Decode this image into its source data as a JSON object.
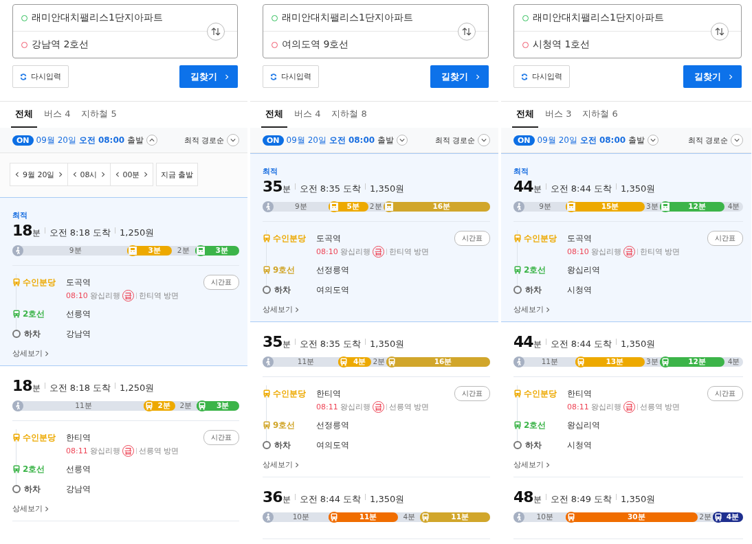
{
  "panels": [
    {
      "origin": "래미안대치팰리스1단지아파트",
      "destination": "강남역 2호선",
      "reset_button": "다시입력",
      "search_button": "길찾기",
      "tabs": [
        {
          "label": "전체",
          "selected": true
        },
        {
          "label": "버스 4",
          "selected": false
        },
        {
          "label": "지하철 5",
          "selected": false
        }
      ],
      "departure": {
        "badge": "ON",
        "datetime": "09월 20일 **오전 08:00**",
        "label": "출발",
        "expanded": true
      },
      "sort": "최적 경로순",
      "time_picker": {
        "fields": [
          "9월 20일",
          "08시",
          "00분"
        ],
        "now_button": "지금 출발"
      },
      "routes": [
        {
          "selected": true,
          "best_label": "최적",
          "minutes": "18",
          "unit": "분",
          "arrival": "오전 8:18 도착",
          "fare": "1,250원",
          "segments": [
            {
              "kind": "walk",
              "label": "9분"
            },
            {
              "kind": "ride",
              "label": "3분",
              "color": "#eda900"
            },
            {
              "kind": "walk",
              "label": "2분"
            },
            {
              "kind": "ride",
              "label": "3분",
              "color": "#3cb449"
            }
          ],
          "legs": [
            {
              "kind": "ride",
              "line": "수인분당",
              "color": "#eda900",
              "station": "도곡역",
              "timetable": "시간표",
              "departure": {
                "time": "08:10",
                "direction": "왕십리행",
                "badge": "급",
                "toward": "한티역 방면"
              }
            },
            {
              "kind": "ride",
              "line": "2호선",
              "color": "#3cb449",
              "station": "선릉역"
            },
            {
              "kind": "exit",
              "line": "하차",
              "station": "강남역"
            }
          ],
          "details_link": "상세보기"
        },
        {
          "selected": false,
          "minutes": "18",
          "unit": "분",
          "arrival": "오전 8:18 도착",
          "fare": "1,250원",
          "segments": [
            {
              "kind": "walk",
              "label": "11분"
            },
            {
              "kind": "ride",
              "label": "2분",
              "color": "#eda900"
            },
            {
              "kind": "walk",
              "label": "2분"
            },
            {
              "kind": "ride",
              "label": "3분",
              "color": "#3cb449"
            }
          ],
          "legs": [
            {
              "kind": "ride",
              "line": "수인분당",
              "color": "#eda900",
              "station": "한티역",
              "timetable": "시간표",
              "departure": {
                "time": "08:11",
                "direction": "왕십리행",
                "badge": "급",
                "toward": "선릉역 방면"
              }
            },
            {
              "kind": "ride",
              "line": "2호선",
              "color": "#3cb449",
              "station": "선릉역"
            },
            {
              "kind": "exit",
              "line": "하차",
              "station": "강남역"
            }
          ],
          "details_link": "상세보기"
        }
      ]
    },
    {
      "origin": "래미안대치팰리스1단지아파트",
      "destination": "여의도역 9호선",
      "reset_button": "다시입력",
      "search_button": "길찾기",
      "tabs": [
        {
          "label": "전체",
          "selected": true
        },
        {
          "label": "버스 4",
          "selected": false
        },
        {
          "label": "지하철 8",
          "selected": false
        }
      ],
      "departure": {
        "badge": "ON",
        "datetime": "09월 20일 **오전 08:00**",
        "label": "출발",
        "expanded": false
      },
      "sort": "최적 경로순",
      "routes": [
        {
          "selected": true,
          "best_label": "최적",
          "minutes": "35",
          "unit": "분",
          "arrival": "오전 8:35 도착",
          "fare": "1,350원",
          "segments": [
            {
              "kind": "walk",
              "label": "9분"
            },
            {
              "kind": "ride",
              "label": "5분",
              "color": "#eda900"
            },
            {
              "kind": "walk",
              "label": "2분"
            },
            {
              "kind": "ride",
              "label": "16분",
              "color": "#d1a62b"
            }
          ],
          "legs": [
            {
              "kind": "ride",
              "line": "수인분당",
              "color": "#eda900",
              "station": "도곡역",
              "timetable": "시간표",
              "departure": {
                "time": "08:10",
                "direction": "왕십리행",
                "badge": "급",
                "toward": "한티역 방면"
              }
            },
            {
              "kind": "ride",
              "line": "9호선",
              "color": "#d1a62b",
              "station": "선정릉역"
            },
            {
              "kind": "exit",
              "line": "하차",
              "station": "여의도역"
            }
          ],
          "details_link": "상세보기"
        },
        {
          "selected": false,
          "minutes": "35",
          "unit": "분",
          "arrival": "오전 8:35 도착",
          "fare": "1,350원",
          "segments": [
            {
              "kind": "walk",
              "label": "11분"
            },
            {
              "kind": "ride",
              "label": "4분",
              "color": "#eda900"
            },
            {
              "kind": "walk",
              "label": "2분"
            },
            {
              "kind": "ride",
              "label": "16분",
              "color": "#d1a62b"
            }
          ],
          "legs": [
            {
              "kind": "ride",
              "line": "수인분당",
              "color": "#eda900",
              "station": "한티역",
              "timetable": "시간표",
              "departure": {
                "time": "08:11",
                "direction": "왕십리행",
                "badge": "급",
                "toward": "선릉역 방면"
              }
            },
            {
              "kind": "ride",
              "line": "9호선",
              "color": "#d1a62b",
              "station": "선정릉역"
            },
            {
              "kind": "exit",
              "line": "하차",
              "station": "여의도역"
            }
          ],
          "details_link": "상세보기"
        },
        {
          "selected": false,
          "minutes": "36",
          "unit": "분",
          "arrival": "오전 8:44 도착",
          "fare": "1,350원",
          "segments": [
            {
              "kind": "walk",
              "label": "10분"
            },
            {
              "kind": "ride",
              "label": "11분",
              "color": "#f06d00"
            },
            {
              "kind": "walk",
              "label": "4분"
            },
            {
              "kind": "ride",
              "label": "11분",
              "color": "#d1a62b"
            }
          ]
        }
      ]
    },
    {
      "origin": "래미안대치팰리스1단지아파트",
      "destination": "시청역 1호선",
      "reset_button": "다시입력",
      "search_button": "길찾기",
      "tabs": [
        {
          "label": "전체",
          "selected": true
        },
        {
          "label": "버스 3",
          "selected": false
        },
        {
          "label": "지하철 6",
          "selected": false
        }
      ],
      "departure": {
        "badge": "ON",
        "datetime": "09월 20일 **오전 08:00**",
        "label": "출발",
        "expanded": false
      },
      "sort": "최적 경로순",
      "routes": [
        {
          "selected": true,
          "best_label": "최적",
          "minutes": "44",
          "unit": "분",
          "arrival": "오전 8:44 도착",
          "fare": "1,350원",
          "segments": [
            {
              "kind": "walk",
              "label": "9분"
            },
            {
              "kind": "ride",
              "label": "15분",
              "color": "#eda900"
            },
            {
              "kind": "walk",
              "label": "3분"
            },
            {
              "kind": "ride",
              "label": "12분",
              "color": "#3cb449"
            },
            {
              "kind": "walk",
              "label": "4분"
            }
          ],
          "legs": [
            {
              "kind": "ride",
              "line": "수인분당",
              "color": "#eda900",
              "station": "도곡역",
              "timetable": "시간표",
              "departure": {
                "time": "08:10",
                "direction": "왕십리행",
                "badge": "급",
                "toward": "한티역 방면"
              }
            },
            {
              "kind": "ride",
              "line": "2호선",
              "color": "#3cb449",
              "station": "왕십리역"
            },
            {
              "kind": "exit",
              "line": "하차",
              "station": "시청역"
            }
          ],
          "details_link": "상세보기"
        },
        {
          "selected": false,
          "minutes": "44",
          "unit": "분",
          "arrival": "오전 8:44 도착",
          "fare": "1,350원",
          "segments": [
            {
              "kind": "walk",
              "label": "11분"
            },
            {
              "kind": "ride",
              "label": "13분",
              "color": "#eda900"
            },
            {
              "kind": "walk",
              "label": "3분"
            },
            {
              "kind": "ride",
              "label": "12분",
              "color": "#3cb449"
            },
            {
              "kind": "walk",
              "label": "4분"
            }
          ],
          "legs": [
            {
              "kind": "ride",
              "line": "수인분당",
              "color": "#eda900",
              "station": "한티역",
              "timetable": "시간표",
              "departure": {
                "time": "08:11",
                "direction": "왕십리행",
                "badge": "급",
                "toward": "선릉역 방면"
              }
            },
            {
              "kind": "ride",
              "line": "2호선",
              "color": "#3cb449",
              "station": "왕십리역"
            },
            {
              "kind": "exit",
              "line": "하차",
              "station": "시청역"
            }
          ],
          "details_link": "상세보기"
        },
        {
          "selected": false,
          "minutes": "48",
          "unit": "분",
          "arrival": "오전 8:49 도착",
          "fare": "1,350원",
          "segments": [
            {
              "kind": "walk",
              "label": "10분"
            },
            {
              "kind": "ride",
              "label": "30분",
              "color": "#f06d00"
            },
            {
              "kind": "walk",
              "label": "2분"
            },
            {
              "kind": "ride",
              "label": "4분",
              "color": "#1f2f8f"
            }
          ]
        }
      ]
    }
  ]
}
